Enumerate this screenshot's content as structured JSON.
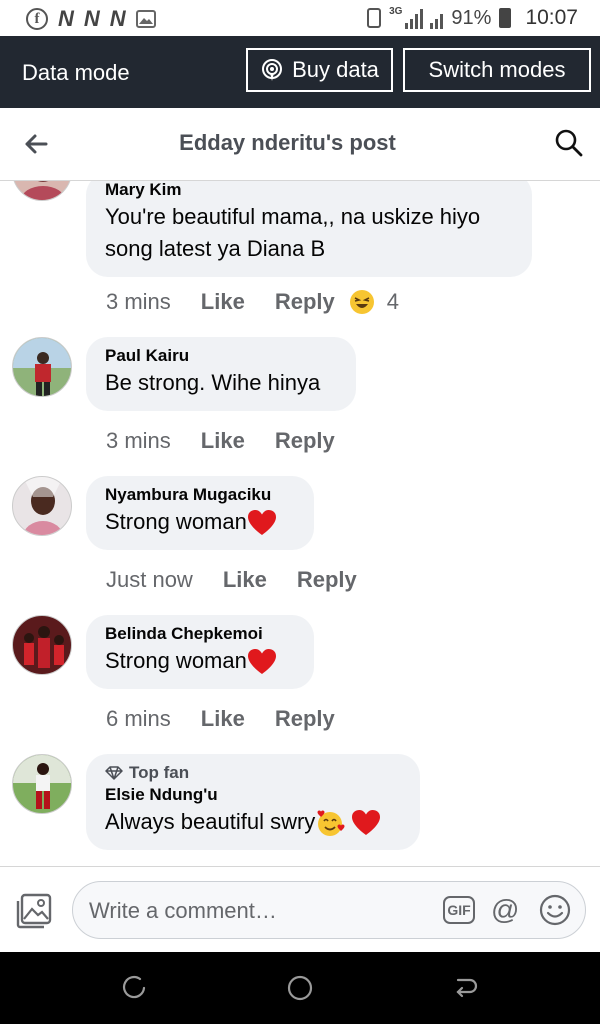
{
  "status_bar": {
    "app_letters": [
      "N",
      "N",
      "N"
    ],
    "network": "3G",
    "battery": "91%",
    "time": "10:07"
  },
  "data_bar": {
    "label": "Data mode",
    "buy_data": "Buy data",
    "switch_modes": "Switch modes"
  },
  "header": {
    "title": "Edday nderitu's post"
  },
  "comments": [
    {
      "author": "Mary Kim",
      "text": "You're beautiful mama,, na uskize hiyo song latest ya Diana B",
      "time": "3 mins",
      "like": "Like",
      "reply": "Reply",
      "reaction_count": "4"
    },
    {
      "author": "Paul Kairu",
      "text": "Be strong. Wihe hinya",
      "time": "3 mins",
      "like": "Like",
      "reply": "Reply"
    },
    {
      "author": "Nyambura Mugaciku",
      "text": "Strong woman",
      "time": "Just now",
      "like": "Like",
      "reply": "Reply"
    },
    {
      "author": "Belinda Chepkemoi",
      "text": "Strong woman",
      "time": "6 mins",
      "like": "Like",
      "reply": "Reply"
    },
    {
      "badge": "Top fan",
      "author": "Elsie Ndung'u",
      "text": "Always beautiful swry"
    }
  ],
  "composer": {
    "placeholder": "Write a comment…",
    "gif_label": "GIF"
  },
  "colors": {
    "data_bar_bg": "#222831",
    "bubble_bg": "#f0f2f5",
    "heart": "#e0191d",
    "laugh_emoji": "#f7c531"
  }
}
